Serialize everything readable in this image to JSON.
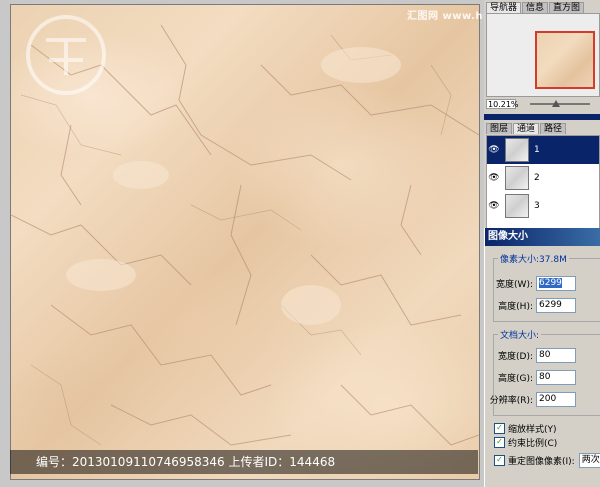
{
  "watermarks": {
    "site": "汇图网 www.huitu.com",
    "center": "汇图网"
  },
  "info_bar": {
    "text": "编号：20130109110746958346 上传者ID：144468"
  },
  "navigator": {
    "tabs": [
      "导航器",
      "信息",
      "直方图"
    ],
    "zoom": "10.21%"
  },
  "channels": {
    "tabs": [
      "图层",
      "通道",
      "路径"
    ],
    "rows": [
      {
        "label": "1"
      },
      {
        "label": "2"
      },
      {
        "label": "3"
      }
    ]
  },
  "dialog": {
    "title": "图像大小",
    "pixel_dimensions": {
      "legend": "像素大小:37.8M",
      "width_label": "宽度(W):",
      "width_value": "6299",
      "height_label": "高度(H):",
      "height_value": "6299"
    },
    "document_size": {
      "legend": "文档大小:",
      "width_label": "宽度(D):",
      "width_value": "80",
      "height_label": "高度(G):",
      "height_value": "80",
      "resolution_label": "分辨率(R):",
      "resolution_value": "200"
    },
    "options": {
      "scale_styles": "缩放样式(Y)",
      "constrain": "约束比例(C)",
      "resample": "重定图像像素(I):",
      "resample_method": "两次立方"
    }
  }
}
